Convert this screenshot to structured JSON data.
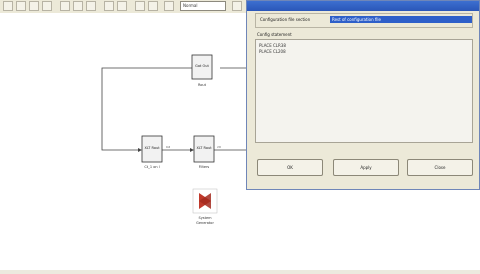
{
  "toolbar": {
    "zoom_value": "Normal"
  },
  "model": {
    "blocks": [
      {
        "title": "Gat Out",
        "label": "Rout"
      },
      {
        "title": "XLT Rout",
        "label": "Ct_1 on l"
      },
      {
        "title": "XLT Rout",
        "label": "Filters"
      }
    ],
    "line_labels": [
      "Int",
      "ctl"
    ],
    "system_generator": {
      "label_line1": "System",
      "label_line2": "Generator"
    }
  },
  "dialog": {
    "section_label": "Configuration file section",
    "section_value": "Rest of configuration file",
    "elements_label": "Config statement",
    "elements": [
      "PLACE CLR38",
      "PLACE CL208"
    ],
    "buttons": {
      "ok": "OK",
      "apply": "Apply",
      "close": "Close"
    }
  }
}
